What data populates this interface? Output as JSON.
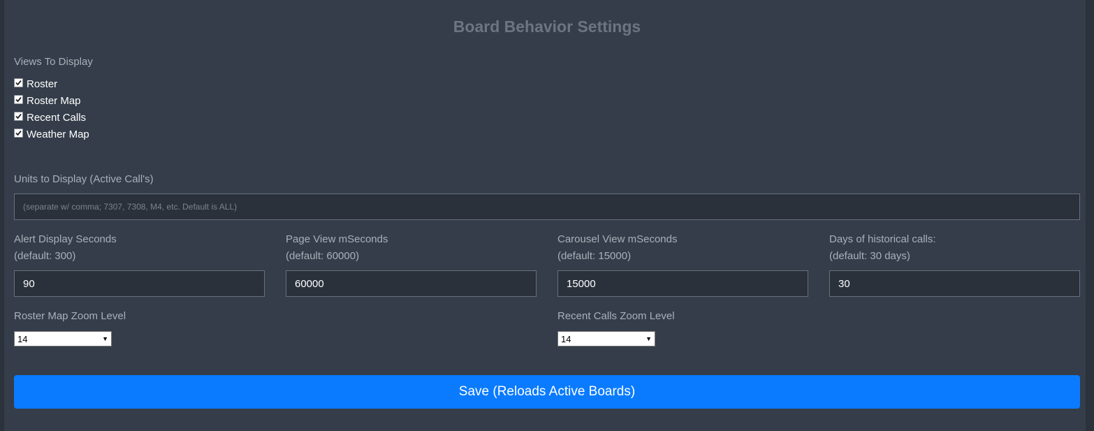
{
  "page_title": "Board Behavior Settings",
  "views": {
    "label": "Views To Display",
    "items": [
      {
        "label": "Roster",
        "checked": true
      },
      {
        "label": "Roster Map",
        "checked": true
      },
      {
        "label": "Recent Calls",
        "checked": true
      },
      {
        "label": "Weather Map",
        "checked": true
      }
    ]
  },
  "units": {
    "label": "Units to Display (Active Call's)",
    "placeholder": "(separate w/ comma; 7307, 7308, M4, etc. Default is ALL)",
    "value": ""
  },
  "fields": [
    {
      "label": "Alert Display Seconds",
      "hint": "(default: 300)",
      "value": "90"
    },
    {
      "label": "Page View mSeconds",
      "hint": "(default: 60000)",
      "value": "60000"
    },
    {
      "label": "Carousel View mSeconds",
      "hint": "(default: 15000)",
      "value": "15000"
    },
    {
      "label": "Days of historical calls:",
      "hint": "(default: 30 days)",
      "value": "30"
    }
  ],
  "zoom": {
    "roster_map": {
      "label": "Roster Map Zoom Level",
      "value": "14"
    },
    "recent_calls": {
      "label": "Recent Calls Zoom Level",
      "value": "14"
    }
  },
  "save_label": "Save (Reloads Active Boards)",
  "colors": {
    "background": "#343d49",
    "input_background": "#2a313b",
    "accent": "#0a7bff"
  }
}
